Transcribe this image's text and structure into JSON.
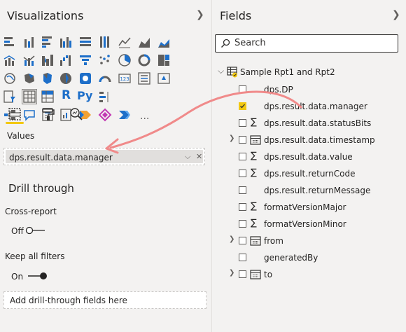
{
  "visualizations": {
    "title": "Visualizations",
    "tabs": [
      "build-visual",
      "format",
      "analytics"
    ],
    "values_label": "Values",
    "values_field": "dps.result.data.manager",
    "drill_through": {
      "title": "Drill through",
      "cross_report_label": "Cross-report",
      "cross_report_state": "Off",
      "keep_filters_label": "Keep all filters",
      "keep_filters_state": "On",
      "drop_placeholder": "Add drill-through fields here"
    },
    "icon_labels": [
      "R",
      "Py",
      "..."
    ]
  },
  "fields": {
    "title": "Fields",
    "search_placeholder": "Search",
    "table_name": "Sample Rpt1 and Rpt2",
    "items": [
      {
        "name": "dps.DP",
        "checked": false,
        "expand": false,
        "kind": "text"
      },
      {
        "name": "dps.result.data.manager",
        "checked": true,
        "expand": false,
        "kind": "text"
      },
      {
        "name": "dps.result.data.statusBits",
        "checked": false,
        "expand": false,
        "kind": "sum"
      },
      {
        "name": "dps.result.data.timestamp",
        "checked": false,
        "expand": true,
        "kind": "date"
      },
      {
        "name": "dps.result.data.value",
        "checked": false,
        "expand": false,
        "kind": "sum"
      },
      {
        "name": "dps.result.returnCode",
        "checked": false,
        "expand": false,
        "kind": "sum"
      },
      {
        "name": "dps.result.returnMessage",
        "checked": false,
        "expand": false,
        "kind": "text"
      },
      {
        "name": "formatVersionMajor",
        "checked": false,
        "expand": false,
        "kind": "sum"
      },
      {
        "name": "formatVersionMinor",
        "checked": false,
        "expand": false,
        "kind": "sum"
      },
      {
        "name": "from",
        "checked": false,
        "expand": true,
        "kind": "date"
      },
      {
        "name": "generatedBy",
        "checked": false,
        "expand": false,
        "kind": "text"
      },
      {
        "name": "to",
        "checked": false,
        "expand": true,
        "kind": "date"
      }
    ]
  },
  "colors": {
    "accent": "#f2c811",
    "arrow": "#f28b8b",
    "icon_dark": "#605e5c",
    "icon_blue": "#1e6fc9"
  }
}
